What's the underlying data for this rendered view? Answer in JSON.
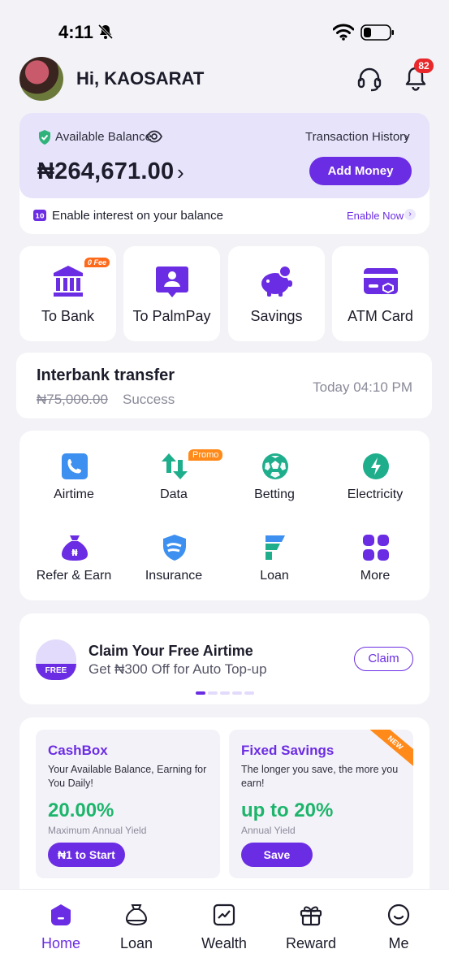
{
  "status_bar": {
    "time": "4:11"
  },
  "header": {
    "greeting": "Hi, KAOSARAT",
    "notification_count": "82"
  },
  "balance": {
    "label": "Available Balance",
    "transaction_history": "Transaction History",
    "amount": "₦264,671.00",
    "add_money": "Add Money",
    "interest_text": "Enable interest on your balance",
    "enable_now": "Enable Now"
  },
  "quick_actions": [
    {
      "label": "To Bank",
      "badge": "0 Fee"
    },
    {
      "label": "To PalmPay"
    },
    {
      "label": "Savings"
    },
    {
      "label": "ATM Card"
    }
  ],
  "transfer": {
    "title": "Interbank transfer",
    "amount": "₦75,000.00",
    "status": "Success",
    "time": "Today 04:10 PM"
  },
  "services": [
    {
      "label": "Airtime"
    },
    {
      "label": "Data",
      "badge": "Promo"
    },
    {
      "label": "Betting"
    },
    {
      "label": "Electricity"
    },
    {
      "label": "Refer & Earn"
    },
    {
      "label": "Insurance"
    },
    {
      "label": "Loan"
    },
    {
      "label": "More"
    }
  ],
  "claim_banner": {
    "badge": "FREE",
    "title": "Claim Your Free Airtime",
    "subtitle": "Get ₦300 Off for Auto Top-up",
    "button": "Claim"
  },
  "savings": [
    {
      "title": "CashBox",
      "description": "Your Available Balance, Earning for You Daily!",
      "rate": "20.00%",
      "note": "Maximum Annual Yield",
      "button": "₦1 to Start"
    },
    {
      "title": "Fixed Savings",
      "description": "The longer you save, the more you earn!",
      "rate": "up to 20%",
      "note": "Annual Yield",
      "button": "Save",
      "ribbon": "NEW"
    }
  ],
  "bottom_nav": [
    {
      "label": "Home",
      "active": true
    },
    {
      "label": "Loan"
    },
    {
      "label": "Wealth"
    },
    {
      "label": "Reward"
    },
    {
      "label": "Me"
    }
  ],
  "colors": {
    "primary": "#6b2de3",
    "balance_card_bg": "#e7e3fb",
    "success_green": "#1db56b",
    "badge_red": "#e8282b",
    "promo_orange": "#ff8a1a"
  }
}
